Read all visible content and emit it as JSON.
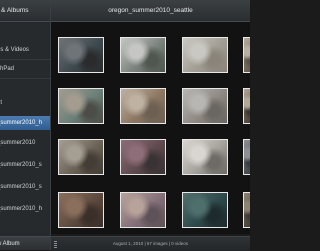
{
  "sidebar": {
    "header_title": "s & Albums",
    "items": [
      {
        "label": "os & Videos"
      },
      {
        "label": "chPad"
      },
      {
        "label": "ht"
      },
      {
        "label": "_summer2010_h"
      },
      {
        "label": "_summer2010"
      },
      {
        "label": "_summer2010_s"
      },
      {
        "label": "_summer2010_s"
      },
      {
        "label": "_summer2010_h"
      }
    ],
    "selected_index": 3,
    "footer_label": "w Album"
  },
  "main": {
    "title": "oregon_summer2010_seattle",
    "status": "August 1, 2010  |  67 images  |  0 videos"
  },
  "photos": [
    {
      "name": "photo-window-view",
      "colors": [
        "#6f7478",
        "#3e4a4f",
        "#2a2b2c"
      ]
    },
    {
      "name": "photo-beach-horizon",
      "colors": [
        "#c6c7c4",
        "#7d847f",
        "#505650"
      ]
    },
    {
      "name": "photo-seagull",
      "colors": [
        "#c9c8c2",
        "#a39e95",
        "#8a847a"
      ]
    },
    {
      "name": "photo-sea-anemone",
      "colors": [
        "#b7b0a2",
        "#7c7466",
        "#5a5348"
      ]
    },
    {
      "name": "photo-green-anemone",
      "colors": [
        "#a39c8f",
        "#6b8079",
        "#4b4d46"
      ]
    },
    {
      "name": "photo-tidepool-pink",
      "colors": [
        "#bfb2a3",
        "#8e7864",
        "#6d6053"
      ]
    },
    {
      "name": "photo-rocks-shells",
      "colors": [
        "#b8b6b3",
        "#8f8a84",
        "#6a6661"
      ]
    },
    {
      "name": "photo-barnacles-1",
      "colors": [
        "#b3a897",
        "#6e6455",
        "#3c3630"
      ]
    },
    {
      "name": "photo-barnacles-2",
      "colors": [
        "#a59e92",
        "#6c6457",
        "#433d35"
      ]
    },
    {
      "name": "photo-purple-tidepool",
      "colors": [
        "#8e6e78",
        "#5f4a4f",
        "#3a3335"
      ]
    },
    {
      "name": "photo-white-shells",
      "colors": [
        "#d9d6d1",
        "#a6a29c",
        "#6e6a66"
      ]
    },
    {
      "name": "photo-mussels",
      "colors": [
        "#8d8f93",
        "#5c5f64",
        "#3a3c40"
      ]
    },
    {
      "name": "photo-starfish-rocks",
      "colors": [
        "#8a6f5d",
        "#5e4a3e",
        "#3a2f29"
      ]
    },
    {
      "name": "photo-pink-seastar",
      "colors": [
        "#b7a39a",
        "#86707a",
        "#5d5257"
      ]
    },
    {
      "name": "photo-green-pool",
      "colors": [
        "#4f6f6c",
        "#2f4a4c",
        "#1d2b2d"
      ]
    },
    {
      "name": "photo-pebble-beach",
      "colors": [
        "#8b8373",
        "#5f584c",
        "#3e3a33"
      ]
    }
  ]
}
